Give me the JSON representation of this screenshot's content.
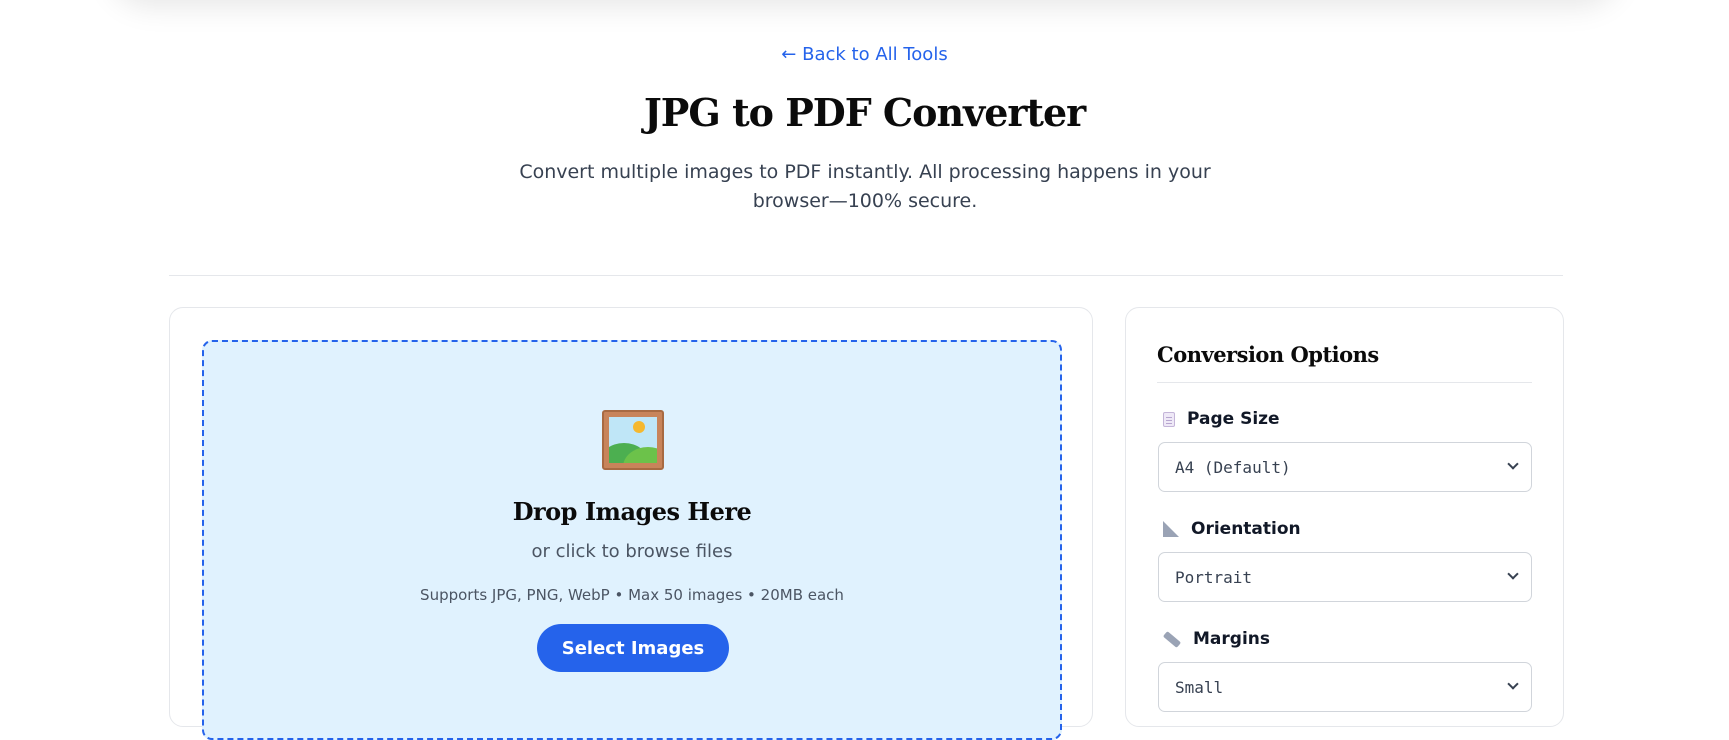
{
  "header": {
    "back_link": "← Back to All Tools",
    "title": "JPG to PDF Converter",
    "subtitle": "Convert multiple images to PDF instantly. All processing happens in your browser—100% secure."
  },
  "upload": {
    "icon": "framed-picture-icon",
    "title": "Drop Images Here",
    "subtitle": "or click to browse files",
    "support": "Supports JPG, PNG, WebP • Max 50 images • 20MB each",
    "button_label": "Select Images"
  },
  "options": {
    "title": "Conversion Options",
    "page_size": {
      "label": "Page Size",
      "icon": "page-icon",
      "value": "A4 (Default)"
    },
    "orientation": {
      "label": "Orientation",
      "icon": "triangle-ruler-icon",
      "value": "Portrait"
    },
    "margins": {
      "label": "Margins",
      "icon": "ruler-icon",
      "value": "Small"
    }
  },
  "colors": {
    "accent": "#2563eb",
    "dropzone_bg": "#e0f2fe"
  }
}
